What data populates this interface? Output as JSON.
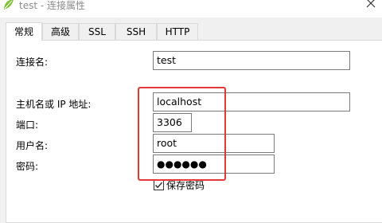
{
  "window": {
    "title": "test - 连接属性",
    "app_icon": "navicat-leaf-icon",
    "close_icon": "close-icon"
  },
  "tabs": [
    {
      "label": "常规",
      "active": true
    },
    {
      "label": "高级",
      "active": false
    },
    {
      "label": "SSL",
      "active": false
    },
    {
      "label": "SSH",
      "active": false
    },
    {
      "label": "HTTP",
      "active": false
    }
  ],
  "form": {
    "connection_name": {
      "label": "连接名:",
      "value": "test"
    },
    "host": {
      "label": "主机名或 IP 地址:",
      "value": "localhost"
    },
    "port": {
      "label": "端口:",
      "value": "3306"
    },
    "username": {
      "label": "用户名:",
      "value": "root"
    },
    "password": {
      "label": "密码:",
      "value": "●●●●●●"
    },
    "save_password": {
      "label": "保存密码",
      "checked": true
    }
  },
  "colors": {
    "highlight_border": "#e53935",
    "app_icon_green": "#7cc22e"
  }
}
